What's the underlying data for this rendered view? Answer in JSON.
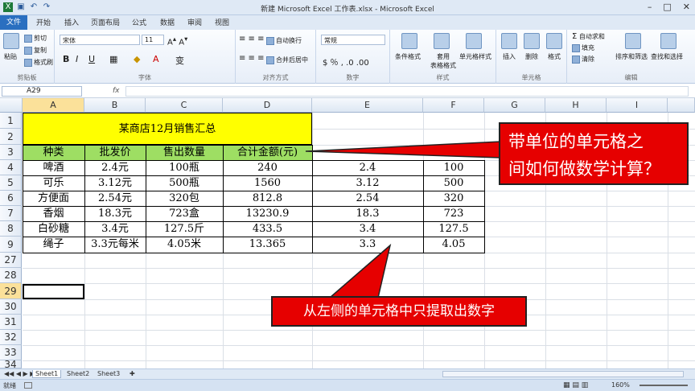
{
  "window": {
    "title": "新建 Microsoft Excel 工作表.xlsx - Microsoft Excel"
  },
  "tabs": [
    "文件",
    "开始",
    "插入",
    "页面布局",
    "公式",
    "数据",
    "审阅",
    "视图"
  ],
  "ribbon": {
    "clipboard": {
      "paste": "粘贴",
      "cut": "剪切",
      "copy": "复制",
      "painter": "格式刷",
      "label": "剪贴板"
    },
    "font": {
      "name": "宋体",
      "size": "11",
      "label": "字体"
    },
    "alignment": {
      "wrap": "自动换行",
      "merge": "合并后居中",
      "label": "对齐方式"
    },
    "number": {
      "format": "常规",
      "label": "数字"
    },
    "styles": {
      "cond": "条件格式",
      "table": "套用\n表格格式",
      "cell": "单元格样式",
      "label": "样式"
    },
    "cells": {
      "insert": "插入",
      "delete": "删除",
      "format": "格式",
      "label": "单元格"
    },
    "editing": {
      "autosum": "自动求和",
      "fill": "填充",
      "clear": "清除",
      "sort": "排序和筛选",
      "find": "查找和选择",
      "label": "编辑"
    }
  },
  "namebox": "A29",
  "fx": "fx",
  "columns": [
    "A",
    "B",
    "C",
    "D",
    "E",
    "F",
    "G",
    "H",
    "I"
  ],
  "rows": [
    "1",
    "2",
    "3",
    "4",
    "5",
    "6",
    "7",
    "8",
    "9",
    "27",
    "28",
    "29",
    "30",
    "31",
    "32",
    "33",
    "34"
  ],
  "table": {
    "title": "某商店12月销售汇总",
    "headers": [
      "种类",
      "批发价",
      "售出数量",
      "合计金额(元)"
    ],
    "rows": [
      [
        "啤酒",
        "2.4元",
        "100瓶",
        "240",
        "2.4",
        "100"
      ],
      [
        "可乐",
        "3.12元",
        "500瓶",
        "1560",
        "3.12",
        "500"
      ],
      [
        "方便面",
        "2.54元",
        "320包",
        "812.8",
        "2.54",
        "320"
      ],
      [
        "香烟",
        "18.3元",
        "723盒",
        "13230.9",
        "18.3",
        "723"
      ],
      [
        "白砂糖",
        "3.4元",
        "127.5斤",
        "433.5",
        "3.4",
        "127.5"
      ],
      [
        "绳子",
        "3.3元每米",
        "4.05米",
        "13.365",
        "3.3",
        "4.05"
      ]
    ]
  },
  "callouts": {
    "top": [
      "带单位的单元格之",
      "间如何做数学计算？"
    ],
    "bottom": "从左侧的单元格中只提取出数字"
  },
  "sheets": [
    "Sheet1",
    "Sheet2",
    "Sheet3"
  ],
  "status": {
    "ready": "就绪",
    "zoom": "160%"
  },
  "colors": {
    "title_fill": "#ffff00",
    "header_fill": "#9ede63",
    "callout": "#e60000"
  }
}
